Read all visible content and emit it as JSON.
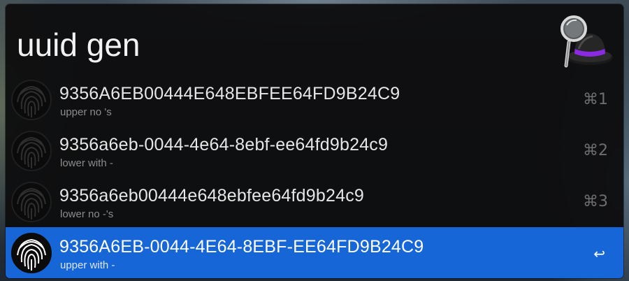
{
  "search": {
    "query": "uuid gen"
  },
  "results": [
    {
      "title": "9356A6EB00444E648EBFEE64FD9B24C9",
      "subtitle": "upper no 's",
      "shortcut": "⌘1",
      "selected": false
    },
    {
      "title": "9356a6eb-0044-4e64-8ebf-ee64fd9b24c9",
      "subtitle": "lower with -",
      "shortcut": "⌘2",
      "selected": false
    },
    {
      "title": "9356a6eb00444e648ebfee64fd9b24c9",
      "subtitle": "lower no -'s",
      "shortcut": "⌘3",
      "selected": false
    },
    {
      "title": "9356A6EB-0044-4E64-8EBF-EE64FD9B24C9",
      "subtitle": "upper with -",
      "shortcut": "↩",
      "selected": true
    }
  ],
  "icons": {
    "app_logo": "alfred-hat-magnifier-icon",
    "result_icon": "fingerprint-icon"
  },
  "colors": {
    "selection": "#1766d8",
    "window_bg": "#0e0e0f",
    "hat_band": "#8a2be2"
  }
}
